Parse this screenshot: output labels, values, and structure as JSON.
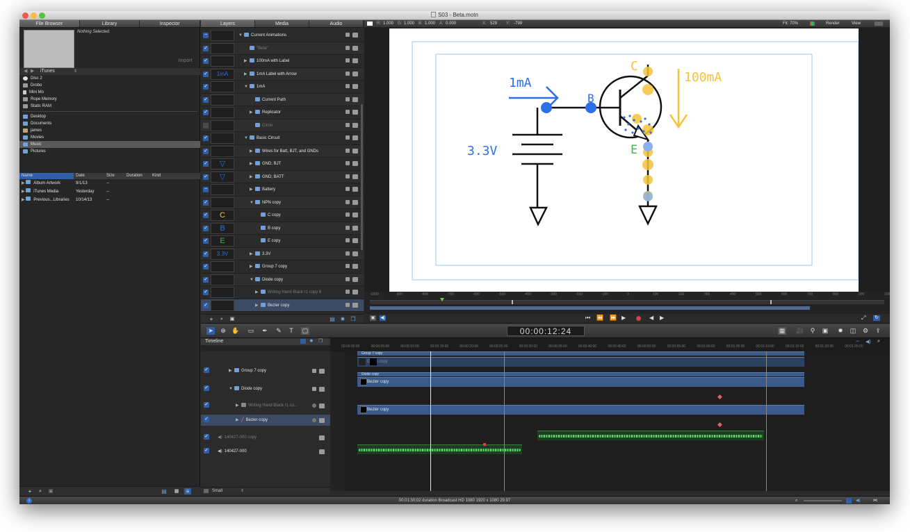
{
  "window": {
    "title": "S03 - Beta.motn"
  },
  "left_tabs": [
    "File Browser",
    "Library",
    "Inspector"
  ],
  "browser": {
    "nothing_selected": "Nothing Selected.",
    "import_label": "Import",
    "source_selector": "iTunes",
    "sources_group1": [
      "Disc 2",
      "Drobo",
      "Mini Mo",
      "Rope Memory",
      "Static RAM"
    ],
    "sources_group2": [
      "Desktop",
      "Documents",
      "james",
      "Movies",
      "Music",
      "Pictures"
    ],
    "selected_source": "Music",
    "file_columns": [
      "Name",
      "Date",
      "Size",
      "Duration",
      "Kind"
    ],
    "files": [
      {
        "name": "Album Artwork",
        "date": "9/1/13",
        "size": "--"
      },
      {
        "name": "iTunes Media",
        "date": "Yesterday",
        "size": "--"
      },
      {
        "name": "Previous...Libraries",
        "date": "10/14/13",
        "size": "--"
      }
    ]
  },
  "project_tabs": [
    "Layers",
    "Media",
    "Audio"
  ],
  "layers": [
    {
      "name": "Current Animations",
      "indent": 0,
      "thumb": "",
      "check": "group",
      "tri": "▼"
    },
    {
      "name": "\"Beta\"",
      "indent": 1,
      "thumb": "",
      "check": "on",
      "tri": "",
      "dim": true
    },
    {
      "name": "100mA with Label",
      "indent": 1,
      "thumb": "",
      "check": "on",
      "tri": "▶"
    },
    {
      "name": "1mA Label with Arrow",
      "indent": 1,
      "thumb": "1mA",
      "check": "on",
      "tri": "▶"
    },
    {
      "name": "1mA",
      "indent": 1,
      "thumb": "",
      "check": "on",
      "tri": "▼"
    },
    {
      "name": "Current Path",
      "indent": 2,
      "thumb": "",
      "check": "on",
      "tri": ""
    },
    {
      "name": "Replicator",
      "indent": 2,
      "thumb": "",
      "check": "on",
      "tri": "▶"
    },
    {
      "name": "Circle",
      "indent": 2,
      "thumb": "",
      "check": "off",
      "tri": "",
      "dim": true
    },
    {
      "name": "Basic Circuit",
      "indent": 1,
      "thumb": "",
      "check": "on",
      "tri": "▼"
    },
    {
      "name": "Wires for Batt, BJT, and GNDs",
      "indent": 2,
      "thumb": "",
      "check": "on",
      "tri": "▶"
    },
    {
      "name": "GND; BJT",
      "indent": 2,
      "thumb": "▽",
      "check": "on",
      "tri": "▶"
    },
    {
      "name": "GND; BATT",
      "indent": 2,
      "thumb": "▽",
      "check": "on",
      "tri": "▶"
    },
    {
      "name": "Battery",
      "indent": 2,
      "thumb": "",
      "check": "group",
      "tri": "▶"
    },
    {
      "name": "NPN copy",
      "indent": 2,
      "thumb": "",
      "check": "on",
      "tri": "▼"
    },
    {
      "name": "C copy",
      "indent": 3,
      "thumb": "C",
      "check": "on",
      "tri": ""
    },
    {
      "name": "B copy",
      "indent": 3,
      "thumb": "B",
      "check": "on",
      "tri": ""
    },
    {
      "name": "E copy",
      "indent": 3,
      "thumb": "E",
      "check": "on",
      "tri": ""
    },
    {
      "name": "3.3V",
      "indent": 2,
      "thumb": "3.3V",
      "check": "on",
      "tri": "▶"
    },
    {
      "name": "Group 7 copy",
      "indent": 2,
      "thumb": "",
      "check": "on",
      "tri": "▶"
    },
    {
      "name": "Diode copy",
      "indent": 2,
      "thumb": "",
      "check": "on",
      "tri": "▼"
    },
    {
      "name": "Writing Hand Black r1 copy 8",
      "indent": 3,
      "thumb": "",
      "check": "on",
      "tri": "▶",
      "dim": true
    },
    {
      "name": "Bezier copy",
      "indent": 3,
      "thumb": "",
      "check": "on",
      "tri": "▶",
      "sel": true
    }
  ],
  "canvas_bar": {
    "values": [
      "1.000",
      "1.000",
      "1.000",
      "0.000"
    ],
    "x_label": "X:",
    "x_val": "529",
    "y_label": "Y:",
    "y_val": "-799",
    "fit": "Fit: 70%",
    "render": "Render",
    "view": "View"
  },
  "canvas_labels": {
    "current_in": "1mA",
    "current_out": "100mA",
    "voltage": "3.3V",
    "collector": "C",
    "base": "B",
    "emitter": "E"
  },
  "ruler_ticks": [
    "-1000",
    "-900",
    "-800",
    "-700",
    "-600",
    "-500",
    "-400",
    "-300",
    "-200",
    "-100",
    "0",
    "100",
    "200",
    "300",
    "400",
    "500",
    "600",
    "700",
    "800",
    "900",
    "1000"
  ],
  "timecode": "00:00:12:24",
  "timeline": {
    "title": "Timeline",
    "ruler_ticks": [
      "00:00:00:00",
      "00:00:05:00",
      "00:00:10:00",
      "00:00:15:00",
      "00:00:20:00",
      "00:00:25:00",
      "00:00:30:00",
      "00:00:35:00",
      "00:00:40:00",
      "00:00:45:00",
      "00:00:50:00",
      "00:00:55:00",
      "00:01:00:00",
      "00:01:05:00",
      "00:01:10:00",
      "00:01:15:00",
      "00:01:20:00",
      "00:01:25:00"
    ],
    "rows": [
      {
        "name": "Group 7 copy"
      },
      {
        "name": "Diode copy"
      },
      {
        "name": "Writing Hand Black r1 co..."
      },
      {
        "name": "Bezier copy"
      },
      {
        "name": "140427-000 copy"
      },
      {
        "name": "140427-000"
      }
    ],
    "clips": {
      "group_top": "Group 7 copy",
      "circle": "Circle copy",
      "diode": "Diode copy",
      "bezier1": "Bezier copy",
      "bezier2": "Bezier copy"
    },
    "size_select": "Small"
  },
  "status": {
    "text": "00:01:30;02 duration Broadcast HD 1080 1920 x 1080 29.97"
  }
}
